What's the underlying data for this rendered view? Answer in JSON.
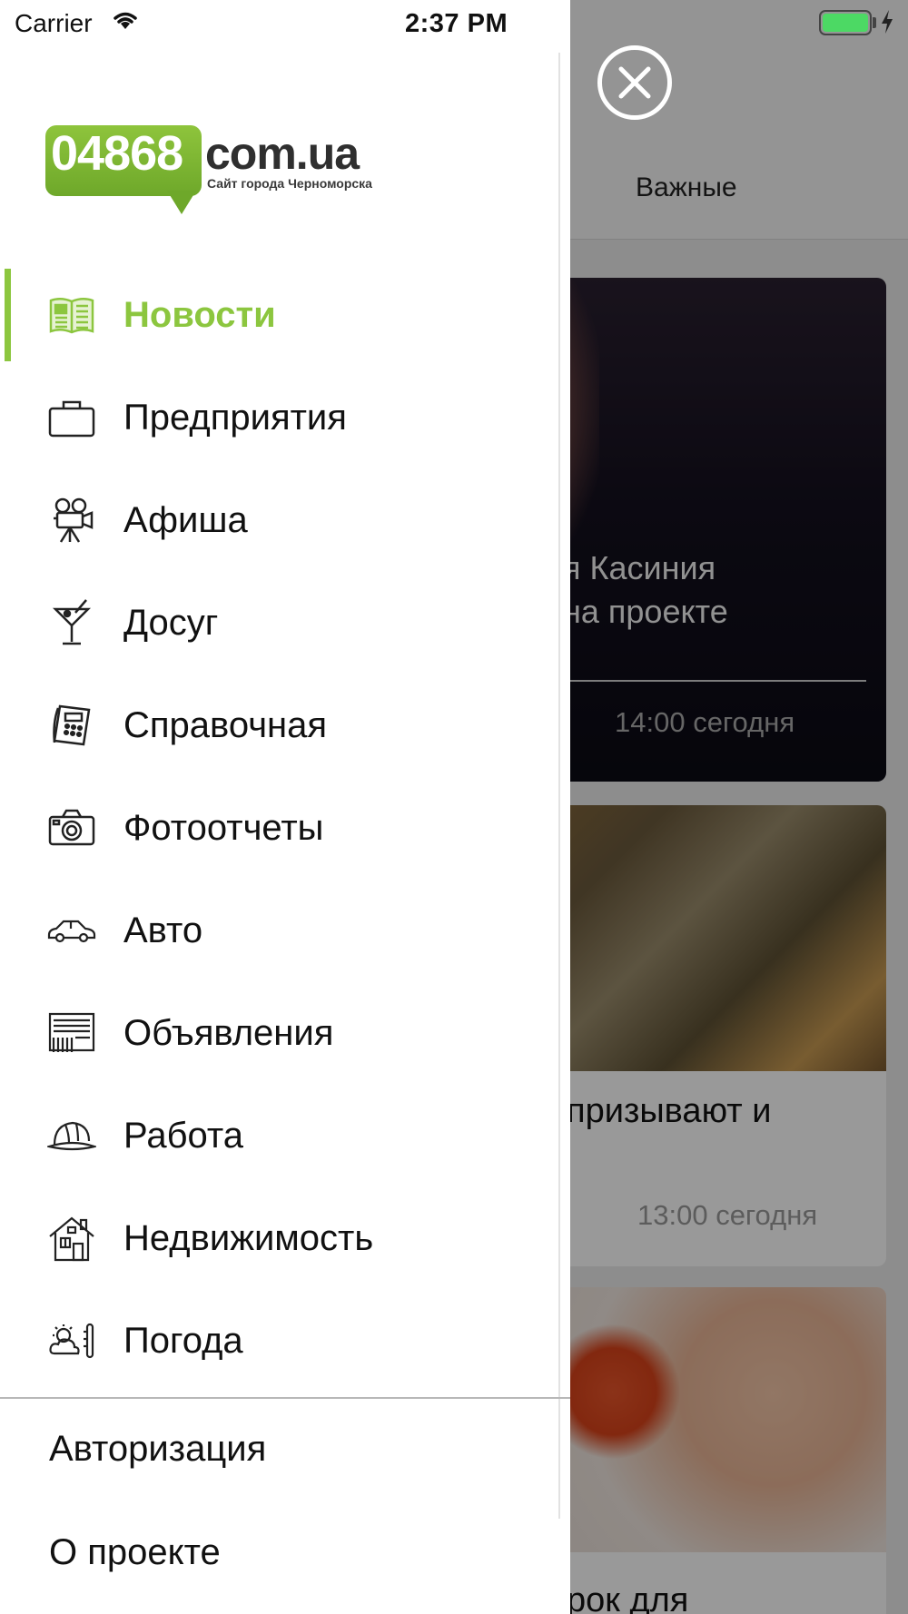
{
  "status_bar": {
    "carrier": "Carrier",
    "time": "2:37 PM",
    "battery_color": "#4cd964"
  },
  "background": {
    "tab_label": "Важные",
    "cards": [
      {
        "title_lines": [
          "я Касиния",
          "на проекте"
        ],
        "time": "14:00 сегодня"
      },
      {
        "title": "призывают и",
        "time": "13:00 сегодня"
      },
      {
        "title": "рок для"
      }
    ]
  },
  "drawer": {
    "logo": {
      "number": "04868",
      "domain": "com.ua",
      "subtitle": "Сайт города Черноморска",
      "brand_color": "#8cc63f"
    },
    "menu": [
      {
        "label": "Новости",
        "icon": "newspaper-icon",
        "active": true
      },
      {
        "label": "Предприятия",
        "icon": "briefcase-icon"
      },
      {
        "label": "Афиша",
        "icon": "movie-camera-icon"
      },
      {
        "label": "Досуг",
        "icon": "cocktail-icon"
      },
      {
        "label": "Справочная",
        "icon": "phone-icon"
      },
      {
        "label": "Фотоотчеты",
        "icon": "camera-icon"
      },
      {
        "label": "Авто",
        "icon": "car-icon"
      },
      {
        "label": "Объявления",
        "icon": "board-icon"
      },
      {
        "label": "Работа",
        "icon": "hard-hat-icon"
      },
      {
        "label": "Недвижимость",
        "icon": "house-icon"
      },
      {
        "label": "Погода",
        "icon": "weather-icon"
      }
    ],
    "bottom": [
      {
        "label": "Авторизация"
      },
      {
        "label": "О проекте"
      }
    ]
  }
}
